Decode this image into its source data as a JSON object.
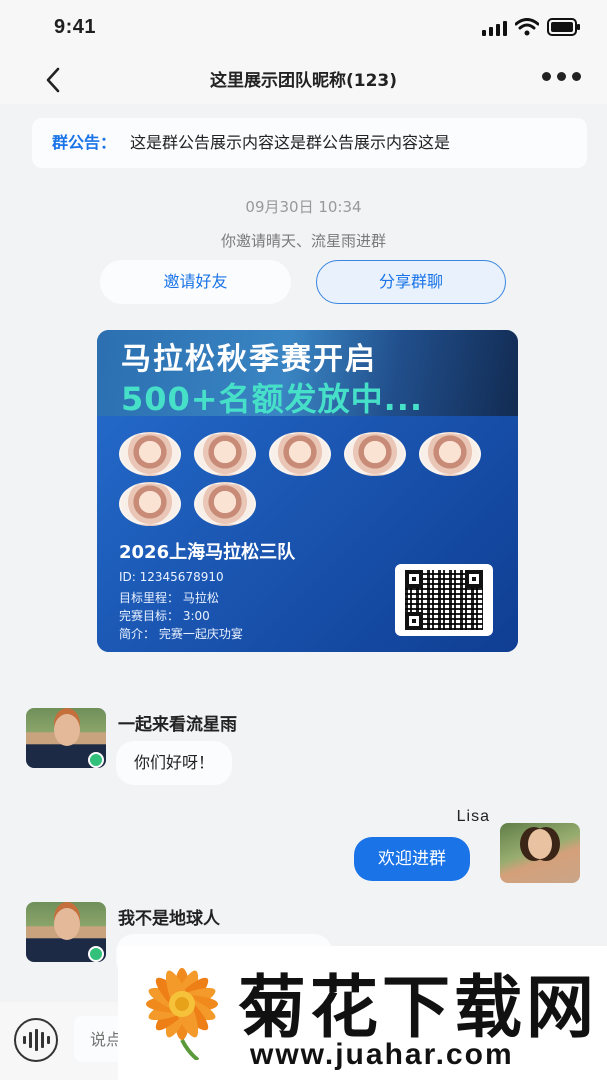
{
  "status_bar": {
    "time": "9:41"
  },
  "header": {
    "title": "这里展示团队昵称(123)"
  },
  "notice": {
    "label": "群公告：",
    "text": "这是群公告展示内容这是群公告展示内容这是"
  },
  "system": {
    "time": "09月30日   10:34",
    "invite_text": "你邀请晴天、流星雨进群",
    "invite_button": "邀请好友",
    "share_button": "分享群聊"
  },
  "poster": {
    "headline1": "马拉松秋季赛开启",
    "headline2": "500+名额发放中...",
    "team_name": "2026上海马拉松三队",
    "id_line": "ID: 12345678910",
    "distance_line": "目标里程： 马拉松",
    "goal_line": "完赛目标： 3:00",
    "intro_line": "简介： 完赛一起庆功宴"
  },
  "messages": [
    {
      "sender": "一起来看流星雨",
      "text": "你们好呀！",
      "side": "left"
    },
    {
      "sender": "Lisa",
      "text": "欢迎进群",
      "side": "right"
    },
    {
      "sender": "我不是地球人",
      "text": "",
      "side": "left"
    }
  ],
  "input": {
    "placeholder": "说点"
  },
  "watermark": {
    "title": "菊花下载网",
    "url": "www.juahar.com"
  },
  "colors": {
    "accent": "#1a74e8",
    "online": "#32c07a",
    "poster_highlight": "#46e0c8"
  }
}
